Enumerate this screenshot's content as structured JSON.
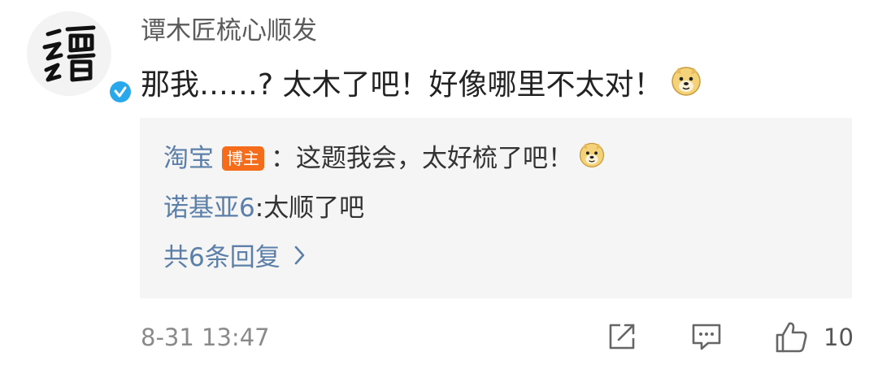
{
  "comment": {
    "username": "谭木匠梳心顺发",
    "text": "那我……? 太木了吧！好像哪里不太对！",
    "emoji": "doge-emoji",
    "timestamp": "8-31 13:47",
    "like_count": "10",
    "verified": true
  },
  "replies": {
    "items": [
      {
        "user": "淘宝",
        "badge": "博主",
        "separator": "：",
        "text": "这题我会，太好梳了吧！",
        "emoji": "doge-emoji"
      },
      {
        "user": "诺基亚6",
        "separator": ": ",
        "text": "太顺了吧"
      }
    ],
    "more_label": "共6条回复"
  },
  "colors": {
    "link_blue": "#5b7fa8",
    "badge_orange": "#f56c1b",
    "verified_blue": "#29a9ec",
    "reply_bg": "#f5f5f5"
  }
}
